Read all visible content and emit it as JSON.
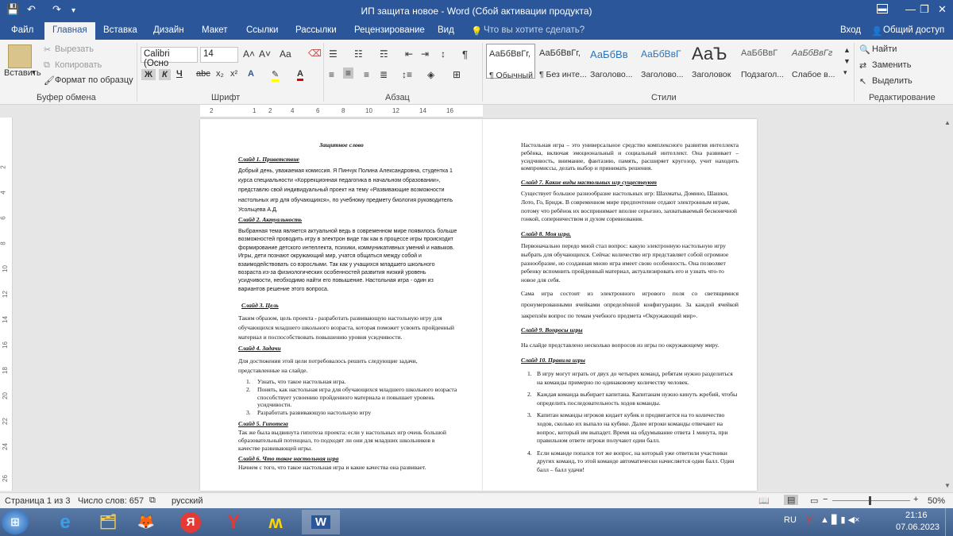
{
  "window": {
    "title": "ИП защита новое - Word (Сбой активации продукта)"
  },
  "tabs": [
    "Файл",
    "Главная",
    "Вставка",
    "Дизайн",
    "Макет",
    "Ссылки",
    "Рассылки",
    "Рецензирование",
    "Вид"
  ],
  "tell_me": "Что вы хотите сделать?",
  "signin": "Вход",
  "share": "Общий доступ",
  "clipboard": {
    "paste": "Вставить",
    "cut": "Вырезать",
    "copy": "Копировать",
    "format_painter": "Формат по образцу",
    "label": "Буфер обмена"
  },
  "font": {
    "name": "Calibri (Осно",
    "size": "14",
    "label": "Шрифт",
    "bold": "Ж",
    "italic": "К",
    "underline": "Ч",
    "strike": "abc",
    "sub": "x₂",
    "sup": "x²"
  },
  "paragraph": {
    "label": "Абзац"
  },
  "styles": {
    "label": "Стили",
    "items": [
      {
        "preview": "АаБбВвГг,",
        "name": "¶ Обычный"
      },
      {
        "preview": "АаБбВвГг,",
        "name": "¶ Без инте..."
      },
      {
        "preview": "АаБбВв",
        "name": "Заголово..."
      },
      {
        "preview": "АаБбВвГ",
        "name": "Заголово..."
      },
      {
        "preview": "АаЪ",
        "name": "Заголовок"
      },
      {
        "preview": "АаБбВвГ",
        "name": "Подзагол..."
      },
      {
        "preview": "АаБбВвГг",
        "name": "Слабое в..."
      }
    ]
  },
  "editing": {
    "find": "Найти",
    "replace": "Заменить",
    "select": "Выделить",
    "label": "Редактирование"
  },
  "ruler_ticks": [
    "2",
    "1",
    "2",
    "4",
    "6",
    "8",
    "10",
    "12",
    "14",
    "16"
  ],
  "vruler_ticks": [
    "2",
    "4",
    "6",
    "8",
    "10",
    "12",
    "14",
    "16",
    "18",
    "20",
    "22",
    "24",
    "26"
  ],
  "page1": {
    "title": "Защитное слово",
    "s1_h": "Слайд 1. Приветствие",
    "s1": "Добрый день, уважаемая комиссия. Я Пинчук Полина Александровна, студентка 1 курса специальности «Коррекционная педагогика в начальном образовании», представлю свой индивидуальный проект на тему «Развивающие возможности настольных игр для обучающихся», по учебному предмету биология руководитель Усольцева А.Д.",
    "s2_h": "Слайд 2. Актуальность",
    "s2": "Выбранная тема является актуальной ведь в современном мире появилось больше возможностей проводить игру в электрон виде так как в процессе игры происходит формирование детского интеллекта, психики, коммуникативных умений и навыков. Игры, дети познают окружающий мир, учатся общаться между собой и взаимодействовать со взрослыми. Так как у учащихся младшего школьного возраста из-за физиологических особенностей развития низкий уровень усидчивости, необходимо найти его повышение. Настольная игра - один из вариантов решение этого вопроса.",
    "s3_h": "Слайд 3. Цель",
    "s3": "Таким образом, цель проекта - разработать развивающую настольную игру для обучающихся младшего школьного возраста, которая поможет усвоить пройденный материал и поспособствовать повышению уровня усидчивости.",
    "s4_h": "Слайд 4. Задачи",
    "s4": "Для достижения этой цели потребовалось решить следующие задачи, представленные на слайде.",
    "s4_list": [
      "Узнать, что такое настольная игра.",
      "Понять, как настольная игра для обучающихся младшего школьного возраста способствует усвоению пройденного материала и повышает уровень усидчивости.",
      "Разработать развивающую настольную игру"
    ],
    "s5_h": "Слайд 5. Гипотеза",
    "s5": "Так же была выдвинута гипотеза проекта: если у настольных игр очень большой образовательный потенциал, то подходят ли они для младших школьников в качестве развивающей игры.",
    "s6_h": "Слайд 6. Что такое настольная игра",
    "s6": "Начнем с того, что такое настольная игра и какие качества она развивает."
  },
  "page2": {
    "p1": "Настольная игра – это универсальное средство комплексного развития интеллекта ребёнка, включая эмоциональный и социальный интеллект. Она развивает – усидчивость, внимание, фантазию, память, расширяет кругозор, учит находить компромиссы, делать выбор и принимать решения.",
    "s7_h": "Слайд 7. Какие виды настольных игр существуют",
    "s7": "Существует большое разнообразие настольных игр: Шахматы, Домино, Шашки, Лото, Го, Бридж. В современном мире предпочтение отдают электронным играм, потому что ребёнок их воспринимает вполне серьезно, захватываемый бесконечной гонкой, соперничеством и духом соревнования.",
    "s8_h": "Слайд 8. Моя игра.",
    "s8": "Первоначально передо мной стал вопрос: какую электронную настольную игру выбрать для обучающихся. Сейчас количество игр представляет собой огромное разнообразие, но созданная мною игра имеет свою особенность. Она позволяет ребенку вспомнить пройденный материал, актуализировать его и узнать что-то новое для себя.",
    "s8b": "Сама игра состоит из электронного игрового поля со светящимися пронумерованными ячейками определённой конфигурации. За каждой ячейкой закреплён вопрос по темам учебного предмета «Окружающий мир».",
    "s9_h": "Слайд 9. Вопросы игры",
    "s9": "На слайде представлено несколько вопросов из игры по окружающему миру.",
    "s10_h": "Слайд 10. Правила игры",
    "s10_list": [
      "В игру могут играть от двух до четырех команд, ребятам нужно разделиться на команды примерно по одинаковому количеству человек.",
      "Каждая команда выбирает капитана. Капитанам нужно кинуть жребий, чтобы определить последовательность ходов команды.",
      "Капитан команды игроков кидает кубик и продвигается на то количество ходов, сколько их выпало на кубике. Далее игроки команды отвечают на вопрос, который им выпадет. Время на обдумывание ответа 1 минута, при правильном ответе игроки получают один балл.",
      "Если команде попался тот же вопрос, на который уже ответили участники других команд, то этой команде автоматически начисляется один балл. Один балл – балл удачи!"
    ]
  },
  "status": {
    "page": "Страница 1 из 3",
    "words": "Число слов: 657",
    "lang": "русский",
    "zoom": "50%"
  },
  "taskbar": {
    "lang": "RU",
    "time": "21:16",
    "date": "07.06.2023"
  }
}
